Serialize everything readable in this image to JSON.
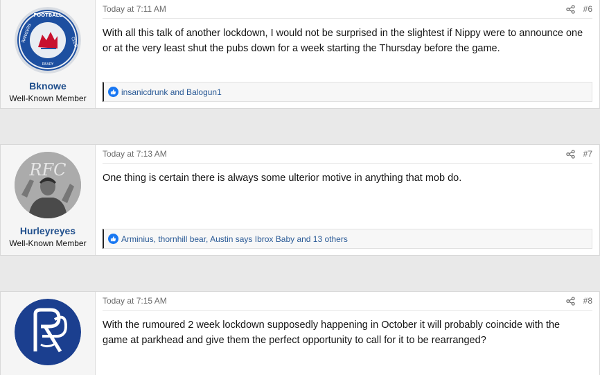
{
  "posts": [
    {
      "username": "Bknowe",
      "user_title": "Well-Known Member",
      "avatar": "rangers-football-club-crest",
      "timestamp": "Today at 7:11 AM",
      "post_number": "#6",
      "body": "With all this talk of another lockdown, I would not be surprised in the slightest if Nippy were to announce one or at the very least shut the pubs down for a week starting the Thursday before the game.",
      "reactions": "insanicdrunk and Balogun1"
    },
    {
      "username": "Hurleyreyes",
      "user_title": "Well-Known Member",
      "avatar": "player-photo",
      "timestamp": "Today at 7:13 AM",
      "post_number": "#7",
      "body": "One thing is certain there is always some ulterior motive in anything that mob do.",
      "reactions": "Arminius, thornhill bear, Austin says Ibrox Baby and 13 others"
    },
    {
      "username": "",
      "user_title": "",
      "avatar": "rfc-monogram",
      "timestamp": "Today at 7:15 AM",
      "post_number": "#8",
      "body": "With the rumoured 2 week lockdown supposedly happening in October it will probably coincide with the game at parkhead and give them the perfect opportunity to call for it to be rearranged?",
      "reactions": ""
    }
  ],
  "colors": {
    "username": "#1f4e8c",
    "reaction_text": "#2a5a96",
    "like_icon": "#1877f2",
    "page_background": "#e9e9e9",
    "rangers_blue": "#1b3f8f"
  },
  "icons": {
    "share": "share-icon",
    "like": "like-icon"
  }
}
